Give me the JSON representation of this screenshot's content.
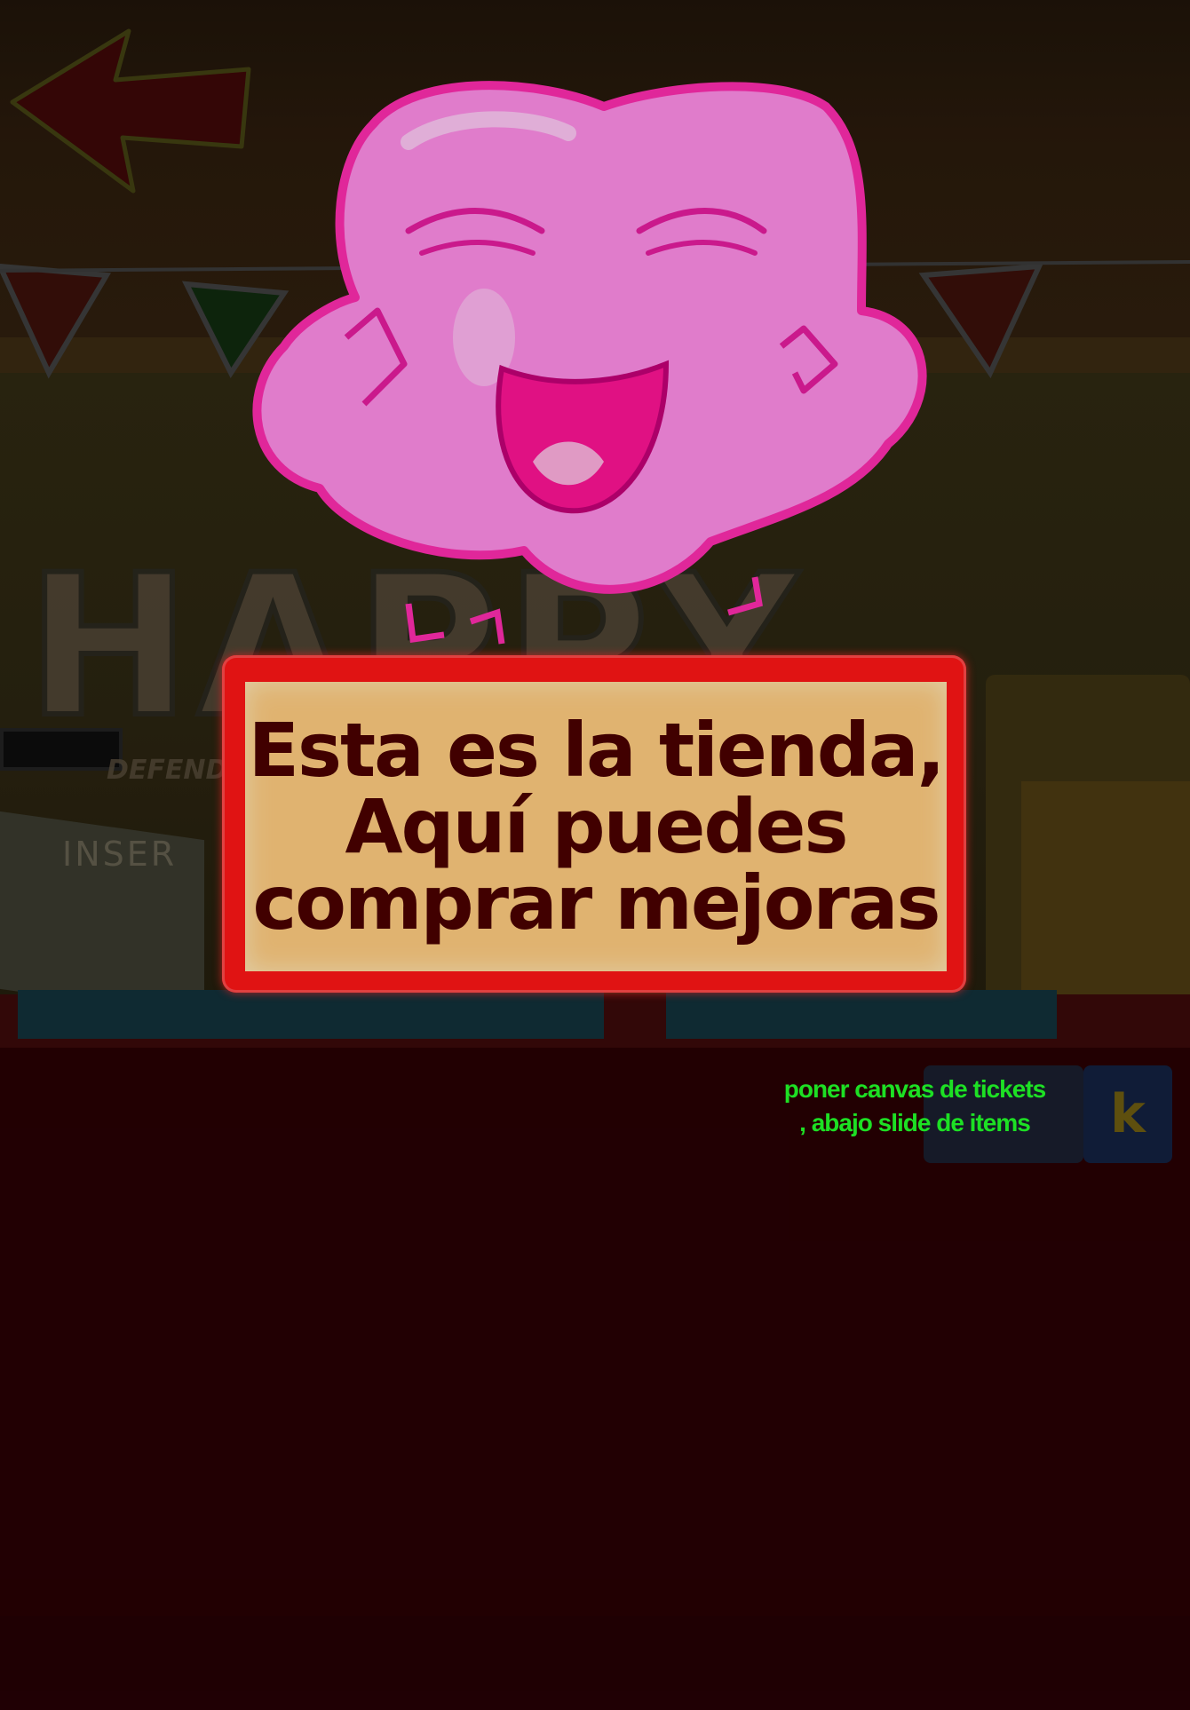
{
  "scene": {
    "background_text": {
      "happy": "HAPPY",
      "insert": "INSER",
      "defend": "DEFEND",
      "block_letter": "k"
    }
  },
  "navigation": {
    "back_arrow_icon": "left-arrow-icon"
  },
  "character": {
    "name_icon": "pink-cloud-mascot",
    "expression": "laughing"
  },
  "dialog": {
    "lines": [
      "Esta es la tienda,",
      "Aquí puedes",
      "comprar mejoras"
    ]
  },
  "dev_note": {
    "lines": [
      "poner canvas de tickets",
      ", abajo slide de items"
    ]
  },
  "colors": {
    "sign_border": "#ff1616",
    "sign_fill": "#ffcc80",
    "sign_text": "#4a0000",
    "mascot_pink": "#ff8ee8",
    "mascot_outline": "#ff2db0",
    "dev_note": "#22ff2a",
    "floor": "#270003"
  }
}
